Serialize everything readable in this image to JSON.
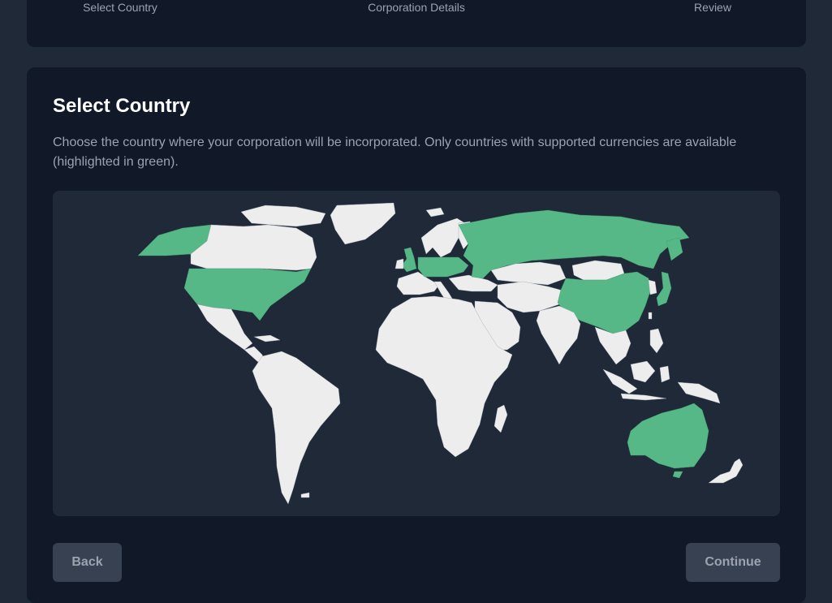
{
  "stepper": {
    "steps": [
      {
        "label": "Select Country"
      },
      {
        "label": "Corporation Details"
      },
      {
        "label": "Review"
      }
    ]
  },
  "select_country": {
    "title": "Select Country",
    "description": "Choose the country where your corporation will be incorporated. Only countries with supported currencies are available (highlighted in green)."
  },
  "map": {
    "colors": {
      "supported": "#55b886",
      "unsupported": "#ededed",
      "background": "#1f2937"
    }
  },
  "actions": {
    "back_label": "Back",
    "continue_label": "Continue"
  }
}
